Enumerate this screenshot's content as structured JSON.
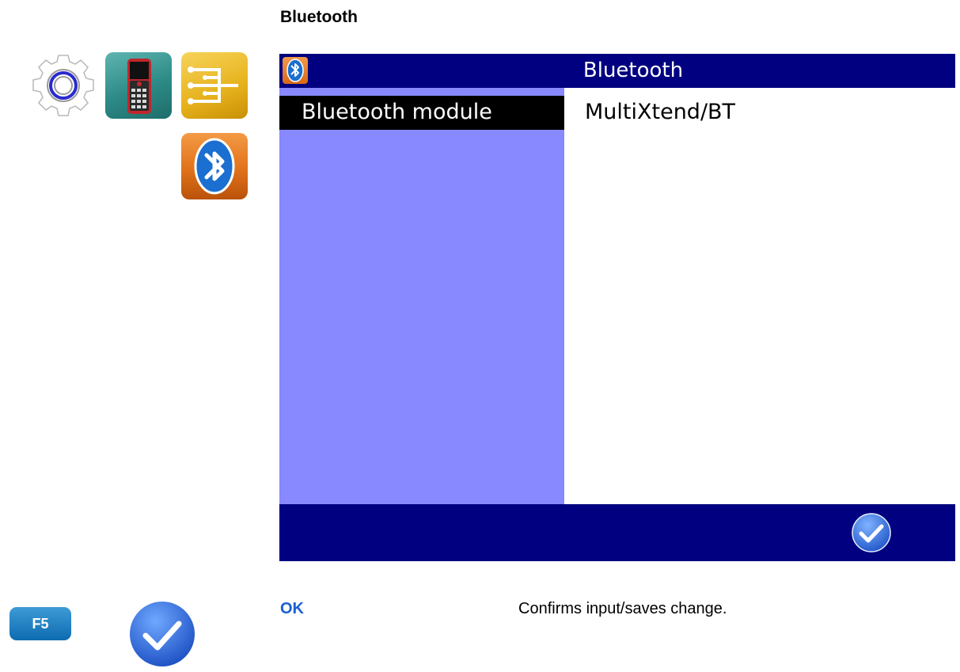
{
  "page": {
    "heading": "Bluetooth"
  },
  "breadcrumb_icons": [
    "gear-icon",
    "handheld-device-icon",
    "network-tree-icon",
    "bluetooth-icon"
  ],
  "screen": {
    "title": "Bluetooth",
    "menu_items": [
      {
        "label": "Bluetooth module",
        "selected": true
      }
    ],
    "value": "MultiXtend/BT",
    "footer_icons": [
      "checkmark-ok-icon"
    ]
  },
  "legend": {
    "key": "F5",
    "name": "OK",
    "description": "Confirms input/saves change."
  },
  "colors": {
    "titlebar": "#000080",
    "left_pane": "#8888ff",
    "selected_item": "#000000",
    "legend_key_text": "#1a5fd1"
  }
}
